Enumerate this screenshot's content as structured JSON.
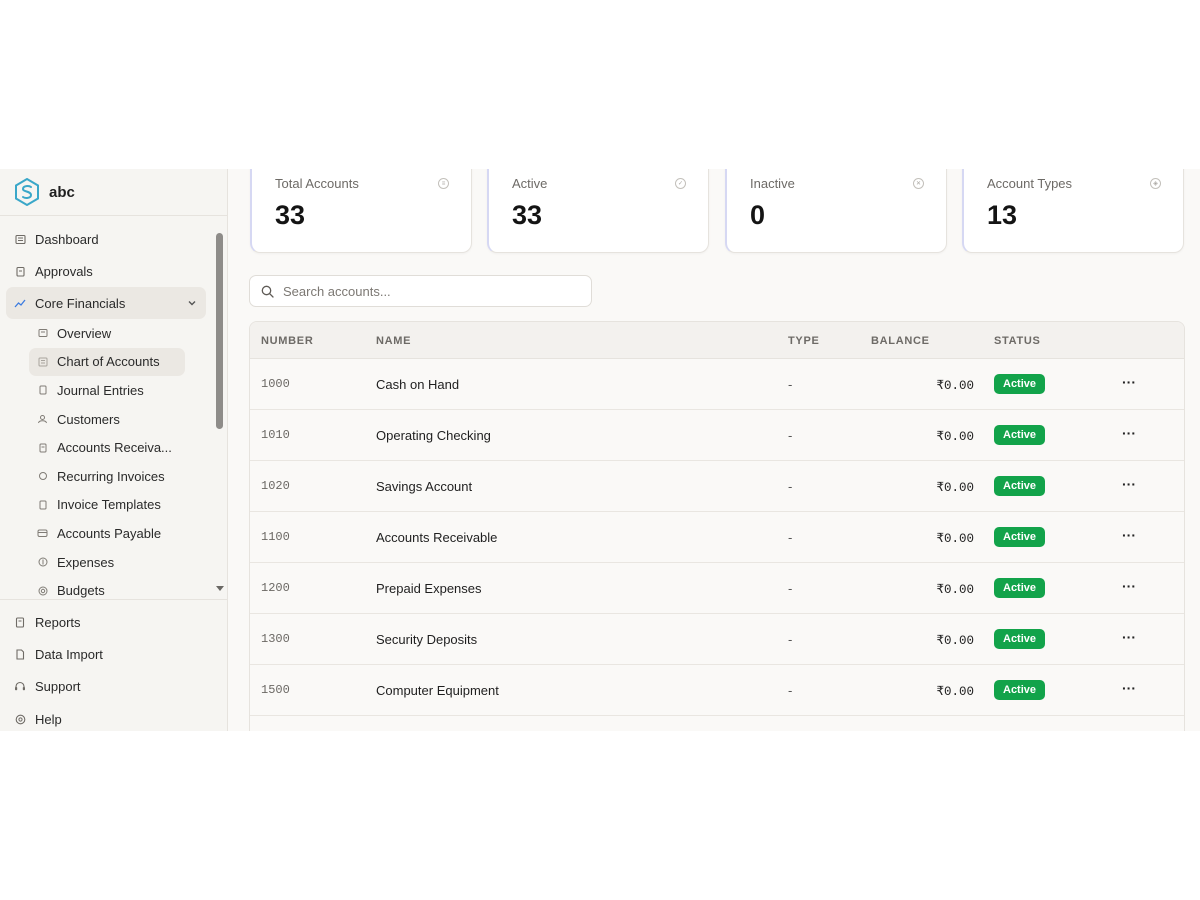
{
  "brand": {
    "name": "abc",
    "accent": "#3aa7c9"
  },
  "sidebar": {
    "top_items": [
      {
        "label": "Dashboard",
        "icon": "dashboard-icon"
      },
      {
        "label": "Approvals",
        "icon": "clipboard-icon"
      }
    ],
    "group": {
      "label": "Core Financials",
      "icon": "trend-line-icon",
      "expanded": true
    },
    "sub_items": [
      {
        "label": "Overview",
        "icon": "overview-icon"
      },
      {
        "label": "Chart of Accounts",
        "icon": "list-icon",
        "active": true
      },
      {
        "label": "Journal Entries",
        "icon": "book-icon"
      },
      {
        "label": "Customers",
        "icon": "users-icon"
      },
      {
        "label": "Accounts Receiva...",
        "icon": "receipt-icon"
      },
      {
        "label": "Recurring Invoices",
        "icon": "repeat-icon"
      },
      {
        "label": "Invoice Templates",
        "icon": "template-icon"
      },
      {
        "label": "Accounts Payable",
        "icon": "wallet-icon"
      },
      {
        "label": "Expenses",
        "icon": "dollar-icon"
      },
      {
        "label": "Budgets",
        "icon": "target-icon"
      }
    ],
    "bottom_items": [
      {
        "label": "Reports",
        "icon": "report-icon"
      },
      {
        "label": "Data Import",
        "icon": "import-icon"
      },
      {
        "label": "Support",
        "icon": "headset-icon"
      },
      {
        "label": "Help",
        "icon": "help-icon"
      }
    ]
  },
  "stats": [
    {
      "label": "Total Accounts",
      "value": "33",
      "icon": "list-icon"
    },
    {
      "label": "Active",
      "value": "33",
      "icon": "check-circle-icon"
    },
    {
      "label": "Inactive",
      "value": "0",
      "icon": "x-circle-icon"
    },
    {
      "label": "Account Types",
      "value": "13",
      "icon": "layers-icon"
    }
  ],
  "search": {
    "placeholder": "Search accounts..."
  },
  "table": {
    "headers": {
      "number": "NUMBER",
      "name": "NAME",
      "type": "TYPE",
      "balance": "BALANCE",
      "status": "STATUS"
    },
    "rows": [
      {
        "number": "1000",
        "name": "Cash on Hand",
        "type": "-",
        "balance": "₹0.00",
        "status": "Active"
      },
      {
        "number": "1010",
        "name": "Operating Checking",
        "type": "-",
        "balance": "₹0.00",
        "status": "Active"
      },
      {
        "number": "1020",
        "name": "Savings Account",
        "type": "-",
        "balance": "₹0.00",
        "status": "Active"
      },
      {
        "number": "1100",
        "name": "Accounts Receivable",
        "type": "-",
        "balance": "₹0.00",
        "status": "Active"
      },
      {
        "number": "1200",
        "name": "Prepaid Expenses",
        "type": "-",
        "balance": "₹0.00",
        "status": "Active"
      },
      {
        "number": "1300",
        "name": "Security Deposits",
        "type": "-",
        "balance": "₹0.00",
        "status": "Active"
      },
      {
        "number": "1500",
        "name": "Computer Equipment",
        "type": "-",
        "balance": "₹0.00",
        "status": "Active"
      }
    ],
    "more_label": "···"
  },
  "colors": {
    "active_badge": "#12a34a",
    "sidebar_bg": "#f6f5f2"
  }
}
